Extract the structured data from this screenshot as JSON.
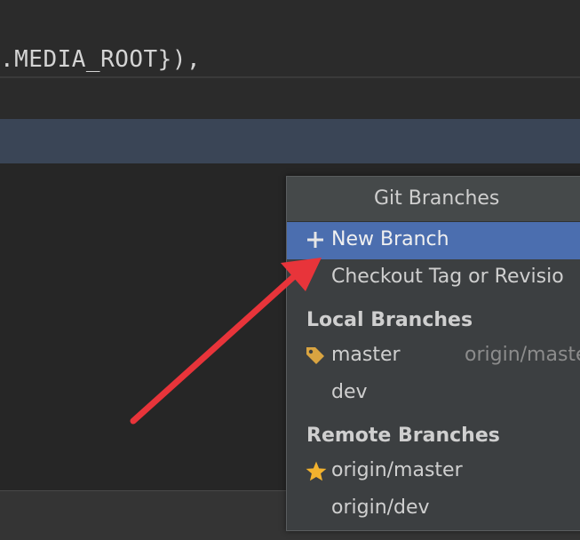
{
  "editor": {
    "code_text": ".MEDIA_ROOT}),"
  },
  "git_branches_popup": {
    "title": "Git Branches",
    "actions": [
      {
        "label": "New Branch",
        "icon": "plus-icon",
        "selected": true
      },
      {
        "label": "Checkout Tag or Revisio",
        "icon": "",
        "selected": false
      }
    ],
    "local_branches": {
      "header": "Local Branches",
      "items": [
        {
          "label": "master",
          "tracking": "origin/maste",
          "icon": "tag-icon"
        },
        {
          "label": "dev",
          "tracking": "",
          "icon": ""
        }
      ]
    },
    "remote_branches": {
      "header": "Remote Branches",
      "items": [
        {
          "label": "origin/master",
          "icon": "star-icon"
        },
        {
          "label": "origin/dev",
          "icon": ""
        }
      ]
    }
  },
  "colors": {
    "selection": "#4b6eaf",
    "annotation_arrow": "#e8343a",
    "tag": "#d9a441",
    "star": "#f2b22e"
  }
}
